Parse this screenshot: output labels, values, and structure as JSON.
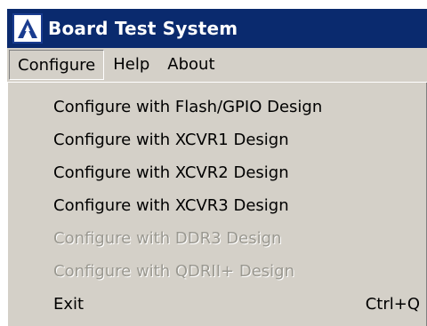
{
  "window": {
    "title": "Board Test System",
    "icon": "altera-logo-icon"
  },
  "menubar": {
    "items": [
      {
        "label": "Configure",
        "active": true
      },
      {
        "label": "Help",
        "active": false
      },
      {
        "label": "About",
        "active": false
      }
    ]
  },
  "dropdown": {
    "items": [
      {
        "label": "Configure with Flash/GPIO Design",
        "enabled": true,
        "shortcut": ""
      },
      {
        "label": "Configure with XCVR1 Design",
        "enabled": true,
        "shortcut": ""
      },
      {
        "label": "Configure with XCVR2 Design",
        "enabled": true,
        "shortcut": ""
      },
      {
        "label": "Configure with XCVR3 Design",
        "enabled": true,
        "shortcut": ""
      },
      {
        "label": "Configure with DDR3 Design",
        "enabled": false,
        "shortcut": ""
      },
      {
        "label": "Configure with QDRII+ Design",
        "enabled": false,
        "shortcut": ""
      },
      {
        "label": "Exit",
        "enabled": true,
        "shortcut": "Ctrl+Q"
      }
    ]
  },
  "colors": {
    "titlebar": "#0a2a6e",
    "menu_background": "#d4d0c8",
    "disabled_text": "#9a9890"
  }
}
